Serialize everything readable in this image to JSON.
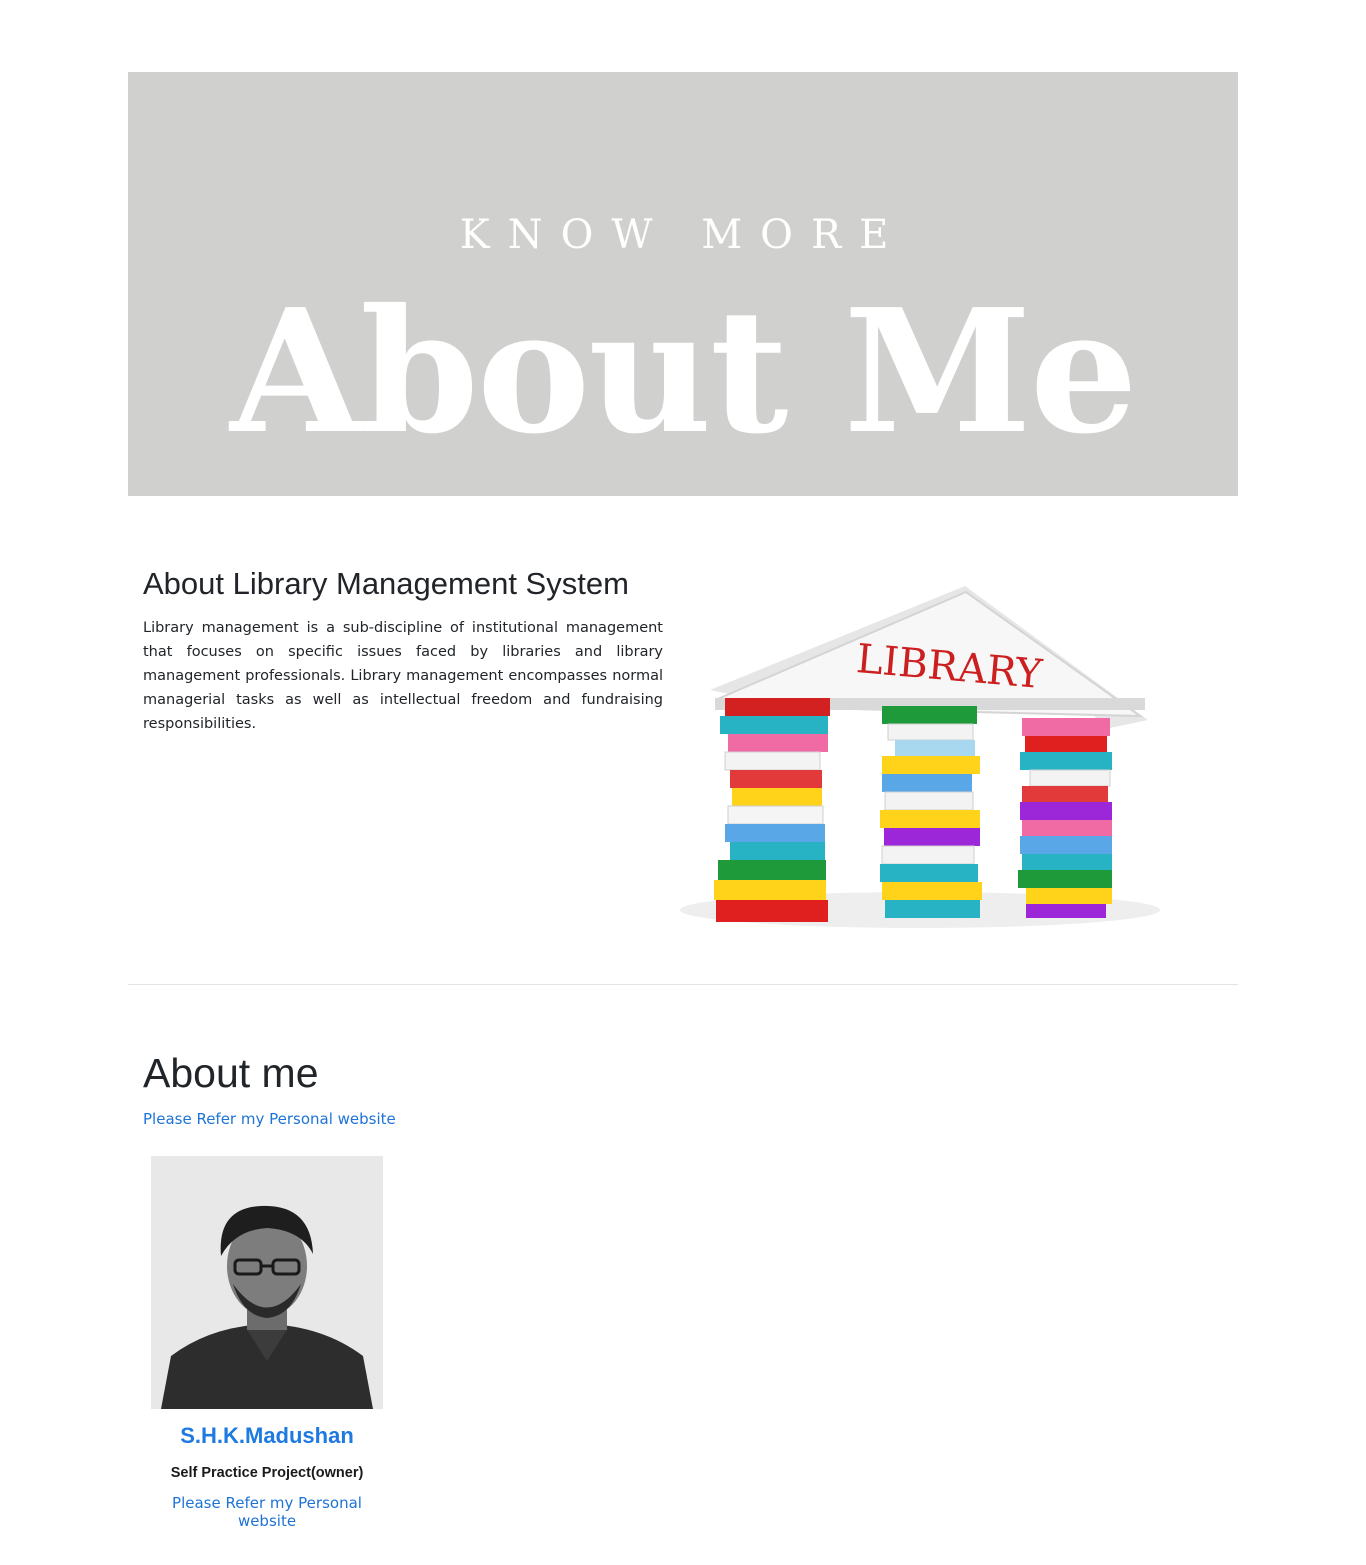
{
  "hero": {
    "subtitle": "KNOW MORE",
    "title": "About Me"
  },
  "library_section": {
    "title": "About Library Management System",
    "text": "Library management is a sub-discipline of institutional management that focuses on specific issues faced by libraries and library management professionals. Library management encompasses normal managerial tasks as well as intellectual freedom and fundraising responsibilities.",
    "image_label": "LIBRARY"
  },
  "about": {
    "title": "About me",
    "link_text": "Please Refer my Personal website"
  },
  "profile": {
    "name": "S.H.K.Madushan",
    "role": "Self Practice Project(owner)",
    "link_text": "Please Refer my Personal website"
  },
  "colors": {
    "hero_bg": "#d0d0ce",
    "link": "#1e73d6",
    "name": "#1e7ae0"
  }
}
